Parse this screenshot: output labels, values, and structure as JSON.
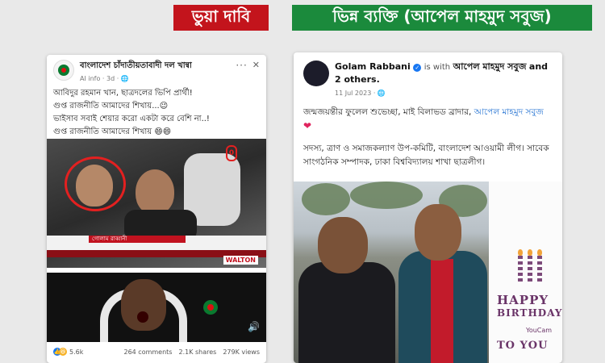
{
  "banners": {
    "left": "ভুয়া দাবি",
    "right": "ভিন্ন ব্যক্তি (আপেল মাহমুদ সবুজ)"
  },
  "left_post": {
    "page_name": "বাংলাদেশ চাঁদাতীয়তাবাদী দল খান্বা",
    "meta": "AI info · 3d · 🌐",
    "line1": "আবিদুর রহমান খান, ছাত্রদলের ভিপি প্রার্থী!",
    "line2": "গুপ্ত রাজনীতি আমাদের শিখায়...😉",
    "line3": "ভাইসাব সবাই শেয়ার করো একটা করে বেশি না..!",
    "line4": "গুপ্ত রাজনীতি আমাদের শিখায় 😄😄",
    "video_lower_name": "গোলাম রাব্বানী",
    "video_lower_role": "সাবেক সাধারণ সম্পাদক, ছাত্রলীগ কেন্দ্রীয় কমিটি",
    "video_sponsor": "WALTON",
    "reactions_count": "5.6k",
    "comments": "264 comments",
    "shares": "2.1K shares",
    "views": "279K views"
  },
  "right_post": {
    "poster": "Golam Rabbani",
    "with_text": "is with",
    "tagged": "আপেল মাহমুদ সবুজ",
    "and_others": "and 2 others.",
    "date": "11 Jul 2023 · 🌐",
    "para1_start": "জন্মজয়ন্তীর ফুলেল শুভেচ্ছা, মাই বিলাভড ব্রাদার,",
    "para1_name": "আপেল মাহমুদ সবুজ",
    "para2": "সদস্য, ত্রাণ ও সমাজকল্যাণ উপ-কমিটি, বাংলাদেশ আওয়ামী লীগ। সাবেক সাংগঠনিক সম্পাদক, ঢাকা বিশ্ববিদ্যালয় শাখা ছাত্রলীগ।",
    "bday_happy": "HAPPY",
    "bday_birthday": "BIRTHDAY",
    "bday_toyou": "TO YOU",
    "youcam": "YouCam"
  }
}
